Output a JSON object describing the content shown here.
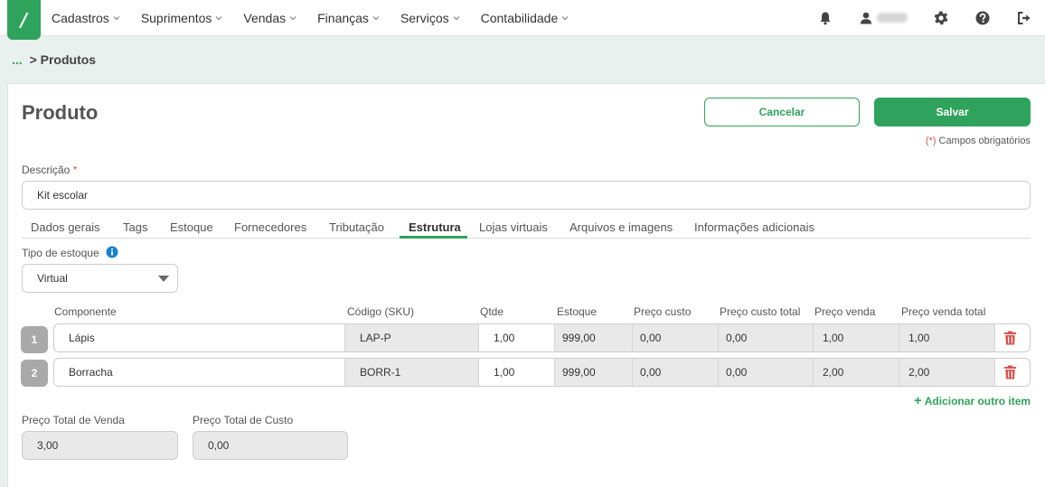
{
  "app": {
    "logo_text": "/",
    "menu": [
      {
        "label": "Cadastros"
      },
      {
        "label": "Suprimentos"
      },
      {
        "label": "Vendas"
      },
      {
        "label": "Finanças"
      },
      {
        "label": "Serviços"
      },
      {
        "label": "Contabilidade"
      }
    ],
    "icons": [
      "bell-icon",
      "user-icon",
      "gear-icon",
      "help-icon",
      "logout-icon"
    ]
  },
  "breadcrumb": {
    "ellipsis": "...",
    "separator": ">",
    "current": "Produtos"
  },
  "page": {
    "title": "Produto",
    "cancel_label": "Cancelar",
    "save_label": "Salvar",
    "required_note_star": "(*)",
    "required_note": "Campos obrigatórios"
  },
  "form": {
    "description_label": "Descrição",
    "description_value": "Kit escolar",
    "stock_type_label": "Tipo de estoque",
    "stock_type_value": "Virtual"
  },
  "tabs": [
    {
      "label": "Dados gerais"
    },
    {
      "label": "Tags"
    },
    {
      "label": "Estoque"
    },
    {
      "label": "Fornecedores"
    },
    {
      "label": "Tributação"
    },
    {
      "label": "Estrutura",
      "active": true
    },
    {
      "label": "Lojas virtuais"
    },
    {
      "label": "Arquivos e imagens"
    },
    {
      "label": "Informações adicionais"
    }
  ],
  "table": {
    "columns": [
      "Componente",
      "Código (SKU)",
      "Qtde",
      "Estoque",
      "Preço custo",
      "Preço custo total",
      "Preço venda",
      "Preço venda total"
    ],
    "rows": [
      {
        "num": "1",
        "componente": "Lápis",
        "sku": "LAP-P",
        "qtde": "1,00",
        "estoque": "999,00",
        "preco_custo": "0,00",
        "preco_custo_total": "0,00",
        "preco_venda": "1,00",
        "preco_venda_total": "1,00"
      },
      {
        "num": "2",
        "componente": "Borracha",
        "sku": "BORR-1",
        "qtde": "1,00",
        "estoque": "999,00",
        "preco_custo": "0,00",
        "preco_custo_total": "0,00",
        "preco_venda": "2,00",
        "preco_venda_total": "2,00"
      }
    ],
    "add_item_label": "Adicionar outro item"
  },
  "totals": {
    "venda_label": "Preço Total de Venda",
    "venda_value": "3,00",
    "custo_label": "Preço Total de Custo",
    "custo_value": "0,00"
  },
  "colors": {
    "accent": "#2fa35b",
    "required": "#d9534f",
    "trash": "#d9534f"
  }
}
